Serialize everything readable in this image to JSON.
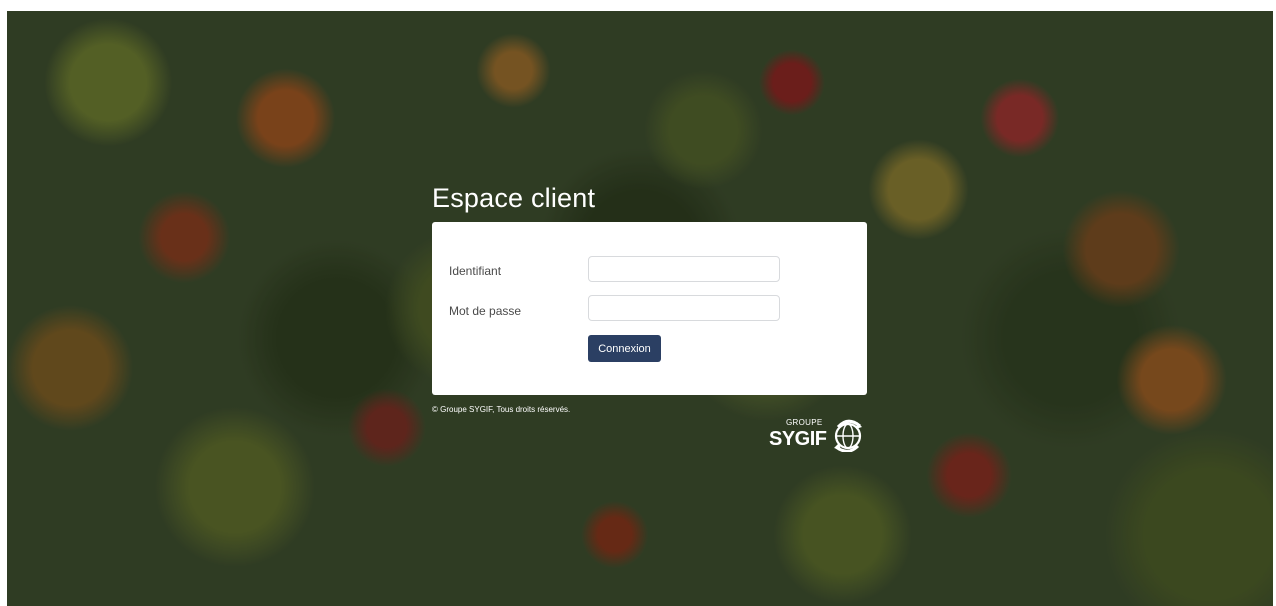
{
  "page": {
    "title": "Espace client"
  },
  "login": {
    "username_label": "Identifiant",
    "username_value": "",
    "password_label": "Mot de passe",
    "password_value": "",
    "submit_label": "Connexion"
  },
  "footer": {
    "copyright": "© Groupe SYGIF, Tous droits réservés."
  },
  "logo": {
    "groupe": "GROUPE",
    "name": "SYGIF",
    "icon": "globe-arrows-icon"
  },
  "colors": {
    "button": "#2b3f63",
    "card": "#ffffff",
    "title_text": "#ffffff"
  }
}
